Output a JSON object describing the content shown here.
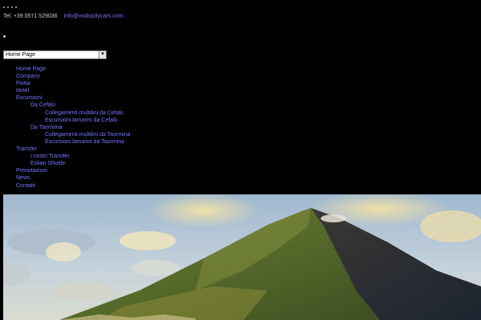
{
  "header": {
    "phone": "Tel. +39 0571 529036",
    "email": "info@visitsicilycars.com"
  },
  "nav_select": {
    "selected": "Home Page"
  },
  "menu": [
    {
      "label": "Home Page",
      "level": 0
    },
    {
      "label": "Company",
      "level": 0
    },
    {
      "label": "Flotta",
      "level": 0
    },
    {
      "label": "Hotel",
      "level": 0
    },
    {
      "label": "Escursioni",
      "level": 0
    },
    {
      "label": "Da Cefalù",
      "level": 1
    },
    {
      "label": "Collegamenti multilini da Cefalù",
      "level": 2
    },
    {
      "label": "Escursioni lamarini da Cefalù",
      "level": 2
    },
    {
      "label": "Da Taormina",
      "level": 1
    },
    {
      "label": "Collegamenti multilini da Taormina",
      "level": 2
    },
    {
      "label": "Escursioni lamarini da Taormina",
      "level": 2
    },
    {
      "label": "Transfer",
      "level": 0
    },
    {
      "label": "I nostri Transfer",
      "level": 1
    },
    {
      "label": "Eolian Shuttle",
      "level": 1
    },
    {
      "label": "Prenotazioni",
      "level": 0
    },
    {
      "label": "News",
      "level": 0
    },
    {
      "label": "Contatti",
      "level": 0
    }
  ],
  "colors": {
    "background": "#000000",
    "link": "#7a73ff"
  }
}
